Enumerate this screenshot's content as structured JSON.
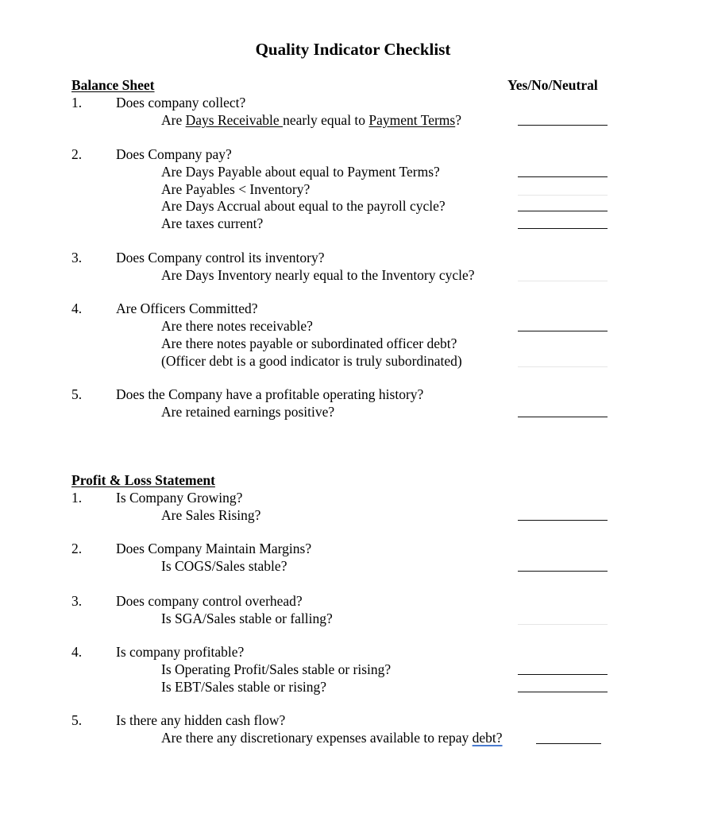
{
  "title": "Quality Indicator Checklist",
  "answer_column_header": "Yes/No/Neutral",
  "sections": [
    {
      "heading": "Balance Sheet",
      "items": [
        {
          "number": "1.",
          "question": "Does company collect?",
          "subquestions": [
            {
              "parts": [
                "Are ",
                "Days Receivable ",
                "nearly equal to ",
                "Payment Terms",
                "?"
              ]
            }
          ]
        },
        {
          "number": "2.",
          "question": "Does Company pay?",
          "subquestions": [
            {
              "text": "Are Days Payable about equal to Payment Terms?"
            },
            {
              "text": "Are Payables < Inventory?"
            },
            {
              "text": "Are Days Accrual about equal to the payroll cycle?"
            },
            {
              "text": "Are taxes current?"
            }
          ]
        },
        {
          "number": "3.",
          "question": "Does Company control its inventory?",
          "subquestions": [
            {
              "text": "Are Days Inventory nearly equal to the Inventory cycle?"
            }
          ]
        },
        {
          "number": "4.",
          "question": "Are Officers Committed?",
          "subquestions": [
            {
              "text": "Are there notes receivable?"
            },
            {
              "text": "Are there notes payable or subordinated officer debt?"
            },
            {
              "text": "(Officer debt is a good indicator is truly subordinated)"
            }
          ]
        },
        {
          "number": "5.",
          "question": "Does the Company have a profitable operating history?",
          "subquestions": [
            {
              "text": "Are retained earnings positive?"
            }
          ]
        }
      ]
    },
    {
      "heading": "Profit & Loss Statement",
      "items": [
        {
          "number": "1.",
          "question": "Is Company Growing?",
          "subquestions": [
            {
              "text": "Are Sales Rising?"
            }
          ]
        },
        {
          "number": "2.",
          "question": "Does Company Maintain Margins?",
          "subquestions": [
            {
              "text": "Is COGS/Sales stable?"
            }
          ]
        },
        {
          "number": "3.",
          "question": "Does company control overhead?",
          "subquestions": [
            {
              "text": "Is SGA/Sales stable or falling?"
            }
          ]
        },
        {
          "number": "4.",
          "question": "Is company profitable?",
          "subquestions": [
            {
              "text": "Is Operating Profit/Sales stable or rising?"
            },
            {
              "text": "Is EBT/Sales stable or rising?"
            }
          ]
        },
        {
          "number": "5.",
          "question": "Is there any hidden cash flow?",
          "subquestions": [
            {
              "parts": [
                "Are there any discretionary expenses available to repay ",
                "debt?"
              ]
            }
          ]
        }
      ]
    }
  ]
}
